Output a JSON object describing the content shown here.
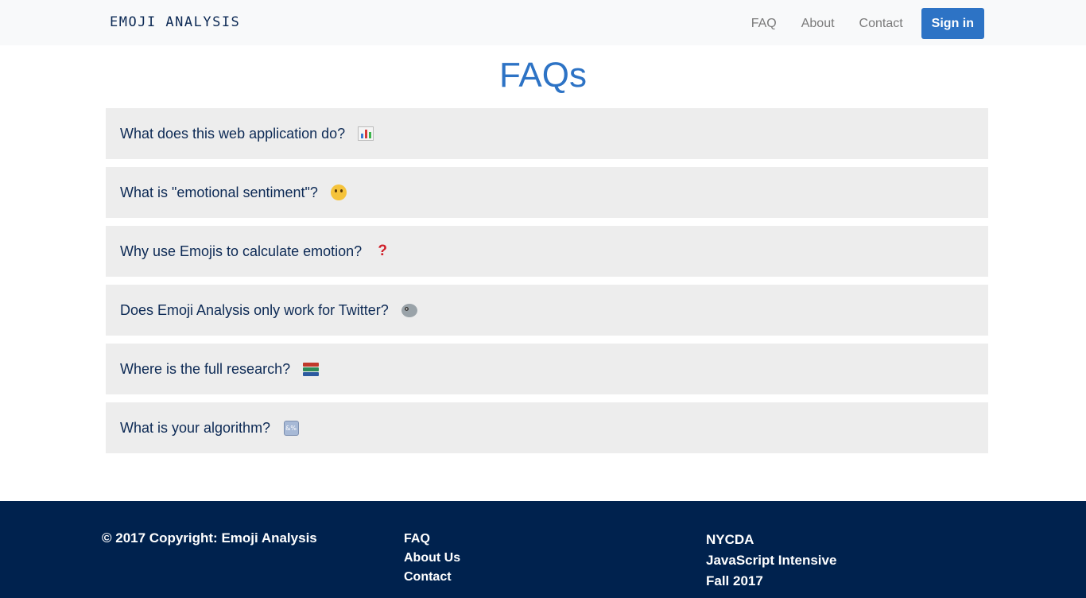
{
  "navbar": {
    "brand": "EMOJI ANALYSIS",
    "links": [
      "FAQ",
      "About",
      "Contact"
    ],
    "signin_label": "Sign in"
  },
  "main": {
    "title": "FAQs",
    "faqs": [
      {
        "question": "What does this web application do?",
        "icon": "bar-chart-icon"
      },
      {
        "question": "What is \"emotional sentiment\"?",
        "icon": "thinking-face-icon"
      },
      {
        "question": "Why use Emojis to calculate emotion?",
        "icon": "question-mark-icon"
      },
      {
        "question": "Does Emoji Analysis only work for Twitter?",
        "icon": "bird-icon"
      },
      {
        "question": "Where is the full research?",
        "icon": "books-icon"
      },
      {
        "question": "What is your algorithm?",
        "icon": "symbols-icon"
      }
    ]
  },
  "footer": {
    "copyright": "© 2017 Copyright: Emoji Analysis",
    "links": [
      "FAQ",
      "About Us",
      "Contact"
    ],
    "info": [
      "NYCDA",
      "JavaScript Intensive",
      "Fall 2017"
    ]
  },
  "colors": {
    "accent": "#2d73c5",
    "navy": "#0d2a55",
    "footer_bg": "#00224e",
    "faq_bg": "#ededed",
    "navbar_bg": "#f8f9fa"
  }
}
